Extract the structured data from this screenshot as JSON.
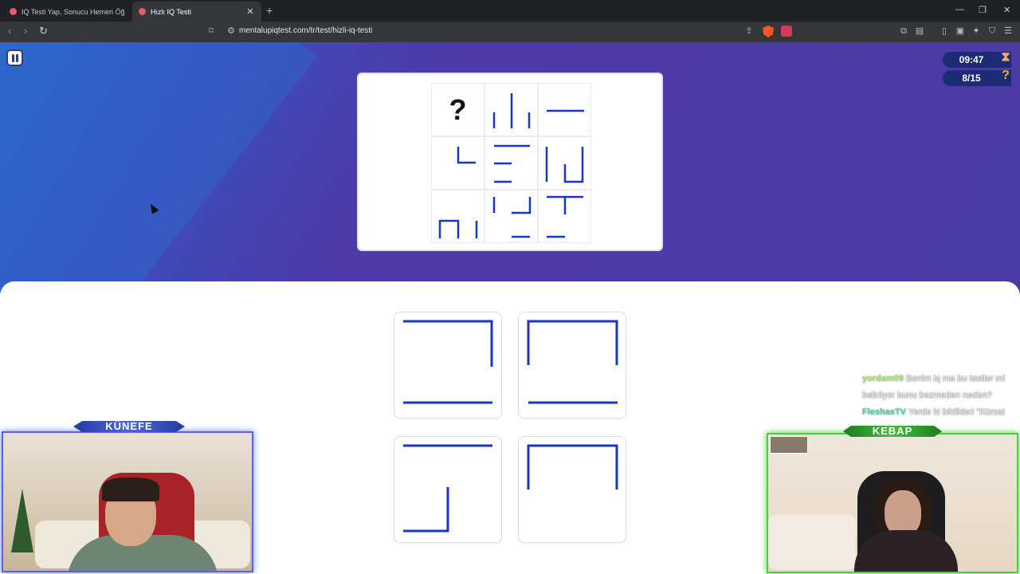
{
  "browser": {
    "tabs": [
      {
        "title": "IQ Testi Yap, Sonucu Hemen Öğren",
        "active": false
      },
      {
        "title": "Hızlı IQ Testi",
        "active": true
      }
    ],
    "new_tab": "+",
    "url": "mentalupiqtest.com/tr/test/hizli-iq-testi",
    "window_controls": {
      "minimize": "—",
      "restore": "❐",
      "close": "✕"
    }
  },
  "quiz": {
    "timer": "09:47",
    "progress": "8/15",
    "question_mark": "?",
    "colors": {
      "line": "#1637c4",
      "hero": "#4a3aa3",
      "stat_bg": "#1c2b74"
    }
  },
  "stream": {
    "left_label": "KÜNEFE",
    "right_label": "KEBAP",
    "chat": [
      {
        "name": "yordam09",
        "name_color": "#a8e07a",
        "message": "Benim iq ma bu testler ml belirliyor bunu bezmeden neden?"
      },
      {
        "name": "FleshasTV",
        "name_color": "#52d1a2",
        "message": "Yerde ki bildikleri \"Kürsat molatal sanalı\""
      }
    ]
  }
}
